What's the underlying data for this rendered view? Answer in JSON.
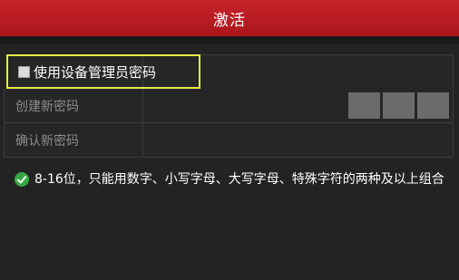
{
  "dialog": {
    "title": "激活"
  },
  "admin_password": {
    "checkbox_label": "使用设备管理员密码",
    "checked": false
  },
  "fields": {
    "new_password_label": "创建新密码",
    "confirm_password_label": "确认新密码"
  },
  "hint": {
    "text": "8-16位，只能用数字、小写字母、大写字母、特殊字符的两种及以上组合",
    "icon": "check-circle-icon"
  },
  "colors": {
    "title_bar": "#b81d23",
    "highlight_border": "#e3ee48",
    "hint_icon": "#35a843"
  }
}
